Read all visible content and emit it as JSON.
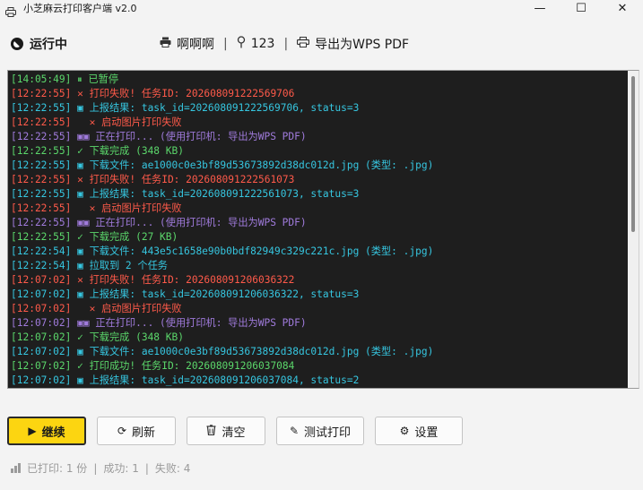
{
  "window": {
    "title": "小芝麻云打印客户端 v2.0",
    "minimize_glyph": "—",
    "maximize_glyph": "☐",
    "close_glyph": "✕"
  },
  "status": {
    "label": "运行中",
    "printer_name": "啊啊啊",
    "location": "123",
    "printer_driver": "导出为WPS PDF",
    "separator": "|"
  },
  "log": [
    {
      "time": "[14:05:49]",
      "icon": "⏸",
      "text": "已暂停",
      "color": "green"
    },
    {
      "time": "[12:22:55]",
      "icon": "✕",
      "text": "打印失败! 任务ID: 202608091222569706",
      "color": "red"
    },
    {
      "time": "[12:22:55]",
      "icon": "▣",
      "text": "上报结果: task_id=202608091222569706, status=3",
      "color": "cyan"
    },
    {
      "time": "[12:22:55]",
      "icon": "  ✕",
      "text": "启动图片打印失败",
      "color": "red"
    },
    {
      "time": "[12:22:55]",
      "icon": "▣▣",
      "text": "正在打印... (使用打印机: 导出为WPS PDF)",
      "color": "purple"
    },
    {
      "time": "[12:22:55]",
      "icon": "✓",
      "text": "下载完成 (348 KB)",
      "color": "green"
    },
    {
      "time": "[12:22:55]",
      "icon": "▣",
      "text": "下载文件: ae1000c0e3bf89d53673892d38dc012d.jpg (类型: .jpg)",
      "color": "cyan"
    },
    {
      "time": "[12:22:55]",
      "icon": "✕",
      "text": "打印失败! 任务ID: 202608091222561073",
      "color": "red"
    },
    {
      "time": "[12:22:55]",
      "icon": "▣",
      "text": "上报结果: task_id=202608091222561073, status=3",
      "color": "cyan"
    },
    {
      "time": "[12:22:55]",
      "icon": "  ✕",
      "text": "启动图片打印失败",
      "color": "red"
    },
    {
      "time": "[12:22:55]",
      "icon": "▣▣",
      "text": "正在打印... (使用打印机: 导出为WPS PDF)",
      "color": "purple"
    },
    {
      "time": "[12:22:55]",
      "icon": "✓",
      "text": "下载完成 (27 KB)",
      "color": "green"
    },
    {
      "time": "[12:22:54]",
      "icon": "▣",
      "text": "下载文件: 443e5c1658e90b0bdf82949c329c221c.jpg (类型: .jpg)",
      "color": "cyan"
    },
    {
      "time": "[12:22:54]",
      "icon": "▣",
      "text": "拉取到 2 个任务",
      "color": "cyan"
    },
    {
      "time": "[12:07:02]",
      "icon": "✕",
      "text": "打印失败! 任务ID: 202608091206036322",
      "color": "red"
    },
    {
      "time": "[12:07:02]",
      "icon": "▣",
      "text": "上报结果: task_id=202608091206036322, status=3",
      "color": "cyan"
    },
    {
      "time": "[12:07:02]",
      "icon": "  ✕",
      "text": "启动图片打印失败",
      "color": "red"
    },
    {
      "time": "[12:07:02]",
      "icon": "▣▣",
      "text": "正在打印... (使用打印机: 导出为WPS PDF)",
      "color": "purple"
    },
    {
      "time": "[12:07:02]",
      "icon": "✓",
      "text": "下载完成 (348 KB)",
      "color": "green"
    },
    {
      "time": "[12:07:02]",
      "icon": "▣",
      "text": "下载文件: ae1000c0e3bf89d53673892d38dc012d.jpg (类型: .jpg)",
      "color": "cyan"
    },
    {
      "time": "[12:07:02]",
      "icon": "✓",
      "text": "打印成功! 任务ID: 202608091206037084",
      "color": "green"
    },
    {
      "time": "[12:07:02]",
      "icon": "▣",
      "text": "上报结果: task_id=202608091206037084, status=2",
      "color": "cyan"
    }
  ],
  "colors": {
    "green": "#5bd76b",
    "red": "#ff5a4a",
    "cyan": "#36c6e0",
    "purple": "#a07bdc",
    "accent": "#fcd511"
  },
  "buttons": {
    "continue": {
      "icon": "▶",
      "label": "继续"
    },
    "refresh": {
      "icon": "⟳",
      "label": "刷新"
    },
    "clear": {
      "icon": "🗑",
      "label": "清空"
    },
    "test_print": {
      "icon": "✎",
      "label": "测试打印"
    },
    "settings": {
      "icon": "⚙",
      "label": "设置"
    }
  },
  "footer": {
    "printed": "已打印: 1 份",
    "success": "成功: 1",
    "failed": "失败: 4",
    "separator": "|"
  }
}
